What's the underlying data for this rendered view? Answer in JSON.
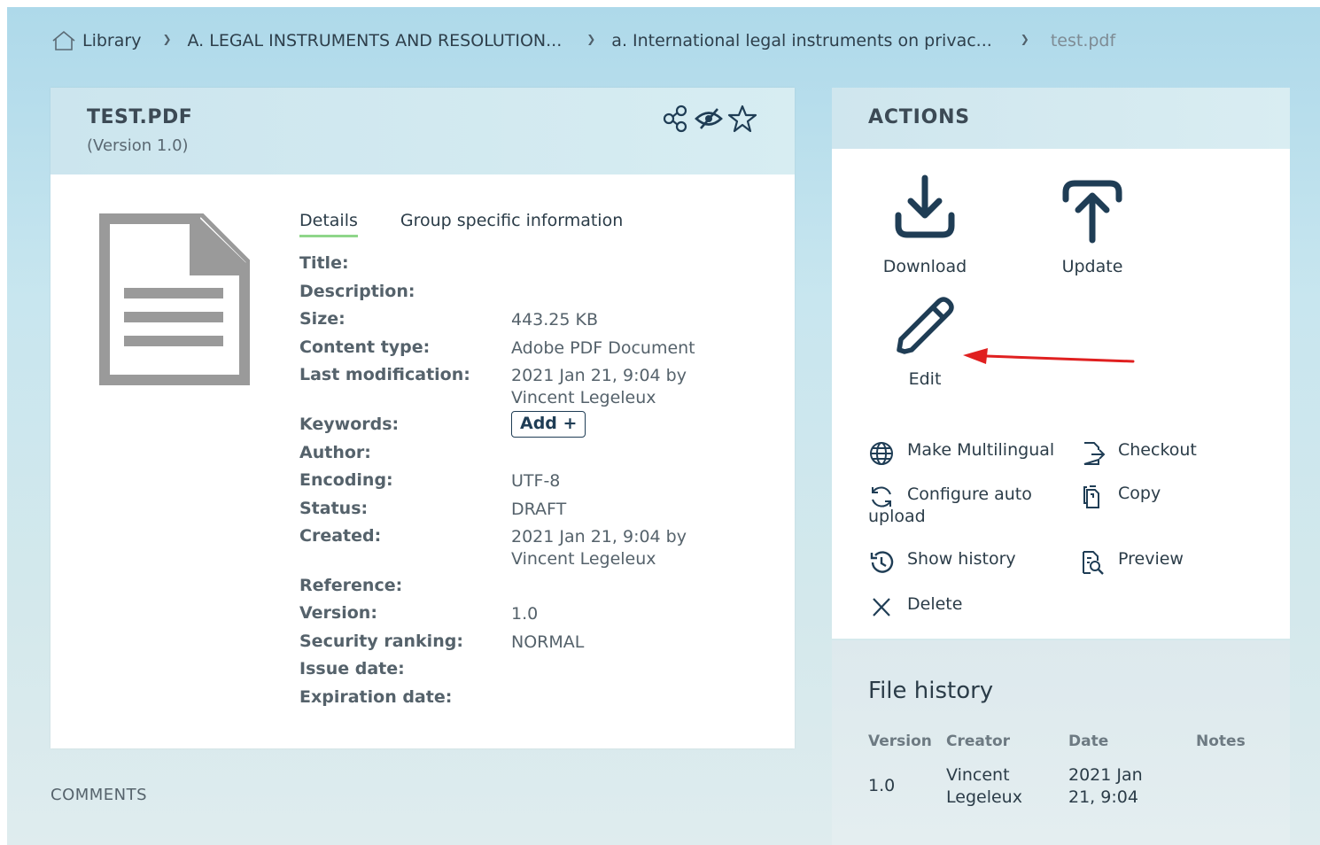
{
  "breadcrumb": {
    "home": "Library",
    "level1": "A. LEGAL INSTRUMENTS AND RESOLUTION...",
    "level2": "a. International legal instruments on privac...",
    "current": "test.pdf"
  },
  "file": {
    "title": "TEST.PDF",
    "version_text": "(Version 1.0)",
    "header_icons": [
      "share-icon",
      "hide-icon",
      "star-icon"
    ]
  },
  "tabs": [
    {
      "label": "Details",
      "active": true
    },
    {
      "label": "Group specific information",
      "active": false
    }
  ],
  "details": {
    "title_label": "Title:",
    "description_label": "Description:",
    "size_label": "Size:",
    "size_value": "443.25 KB",
    "content_type_label": "Content type:",
    "content_type_value": "Adobe PDF Document",
    "last_mod_label": "Last modification:",
    "last_mod_value_1": "2021 Jan 21, 9:04 by",
    "last_mod_value_2": "Vincent Legeleux",
    "keywords_label": "Keywords:",
    "keywords_add": "Add +",
    "author_label": "Author:",
    "encoding_label": "Encoding:",
    "encoding_value": "UTF-8",
    "status_label": "Status:",
    "status_value": "DRAFT",
    "created_label": "Created:",
    "created_value_1": "2021 Jan 21, 9:04 by",
    "created_value_2": "Vincent Legeleux",
    "reference_label": "Reference:",
    "version_label": "Version:",
    "version_value": "1.0",
    "security_label": "Security ranking:",
    "security_value": "NORMAL",
    "issue_label": "Issue date:",
    "expiration_label": "Expiration date:"
  },
  "comments_label": "COMMENTS",
  "actions": {
    "title": "ACTIONS",
    "download": "Download",
    "update": "Update",
    "edit": "Edit",
    "make_multilingual": "Make Multilingual",
    "checkout": "Checkout",
    "configure_1": "Configure auto",
    "configure_2": "upload",
    "copy": "Copy",
    "show_history": "Show history",
    "preview": "Preview",
    "delete": "Delete"
  },
  "file_history": {
    "title": "File history",
    "columns": [
      "Version",
      "Creator",
      "Date",
      "Notes"
    ],
    "rows": [
      {
        "version": "1.0",
        "creator_1": "Vincent",
        "creator_2": "Legeleux",
        "date_1": "2021 Jan",
        "date_2": "21, 9:04",
        "notes": ""
      }
    ]
  },
  "colors": {
    "accent_tab": "#8fd68a",
    "annotation_arrow": "#e02020",
    "icon_dark": "#1f3d55"
  }
}
